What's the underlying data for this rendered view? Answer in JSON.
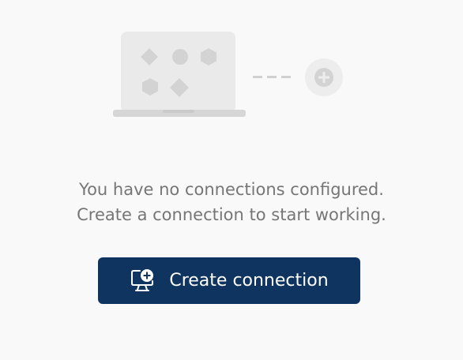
{
  "empty_state": {
    "message_line_1": "You have no connections configured.",
    "message_line_2": "Create a connection to start working.",
    "create_button_label": "Create connection",
    "create_button_icon": "monitor-plus-icon",
    "illustration_icons": [
      "laptop-icon",
      "plus-circle-icon"
    ]
  },
  "colors": {
    "background": "#f9f9f9",
    "button_background": "#0f3460",
    "button_text": "#ffffff",
    "message_text": "#767676",
    "illustration_light": "#ececec",
    "illustration_shape": "#d4d4d4"
  }
}
